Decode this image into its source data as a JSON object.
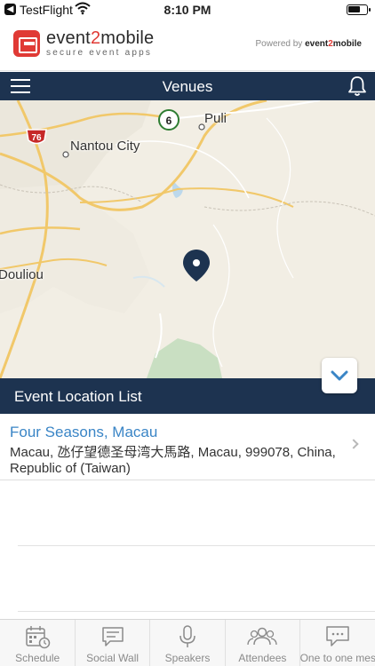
{
  "status_bar": {
    "back_app": "TestFlight",
    "time": "8:10 PM",
    "battery_level": 0.7
  },
  "brand": {
    "name_main": "event",
    "name_accent": "2",
    "name_tail": "mobile",
    "tagline": "secure event apps",
    "powered_prefix": "Powered by",
    "powered_brand_main": "event",
    "powered_brand_accent": "2",
    "powered_brand_tail": "mobile"
  },
  "navbar": {
    "title": "Venues",
    "menu_icon": "hamburger-icon",
    "notification_icon": "bell-icon"
  },
  "map": {
    "labels": {
      "puli": "Puli",
      "nantou": "Nantou City",
      "douliou": "Douliou",
      "route_6": "6",
      "route_76": "76"
    }
  },
  "section": {
    "title": "Event Location List"
  },
  "venues": [
    {
      "name": "Four Seasons, Macau",
      "address": "Macau, 氹仔望德圣母湾大馬路, Macau, 999078, China, Republic of (Taiwan)"
    }
  ],
  "tabs": [
    {
      "label": "Schedule",
      "icon": "calendar-icon"
    },
    {
      "label": "Social Wall",
      "icon": "chat-icon"
    },
    {
      "label": "Speakers",
      "icon": "microphone-icon"
    },
    {
      "label": "Attendees",
      "icon": "people-icon"
    },
    {
      "label": "One to one mes",
      "icon": "message-icon"
    }
  ],
  "colors": {
    "nav_bg": "#1d3350",
    "brand_red": "#e03a35",
    "link_blue": "#3a85c6"
  }
}
